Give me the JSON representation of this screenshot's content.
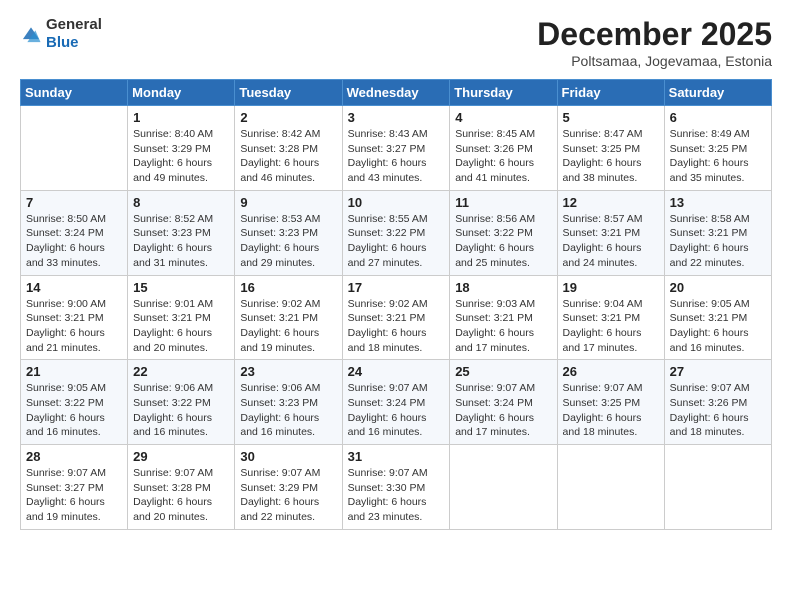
{
  "logo": {
    "general": "General",
    "blue": "Blue"
  },
  "title": "December 2025",
  "location": "Poltsamaa, Jogevamaa, Estonia",
  "days_of_week": [
    "Sunday",
    "Monday",
    "Tuesday",
    "Wednesday",
    "Thursday",
    "Friday",
    "Saturday"
  ],
  "weeks": [
    [
      {
        "day": "",
        "sunrise": "",
        "sunset": "",
        "daylight": ""
      },
      {
        "day": "1",
        "sunrise": "Sunrise: 8:40 AM",
        "sunset": "Sunset: 3:29 PM",
        "daylight": "Daylight: 6 hours and 49 minutes."
      },
      {
        "day": "2",
        "sunrise": "Sunrise: 8:42 AM",
        "sunset": "Sunset: 3:28 PM",
        "daylight": "Daylight: 6 hours and 46 minutes."
      },
      {
        "day": "3",
        "sunrise": "Sunrise: 8:43 AM",
        "sunset": "Sunset: 3:27 PM",
        "daylight": "Daylight: 6 hours and 43 minutes."
      },
      {
        "day": "4",
        "sunrise": "Sunrise: 8:45 AM",
        "sunset": "Sunset: 3:26 PM",
        "daylight": "Daylight: 6 hours and 41 minutes."
      },
      {
        "day": "5",
        "sunrise": "Sunrise: 8:47 AM",
        "sunset": "Sunset: 3:25 PM",
        "daylight": "Daylight: 6 hours and 38 minutes."
      },
      {
        "day": "6",
        "sunrise": "Sunrise: 8:49 AM",
        "sunset": "Sunset: 3:25 PM",
        "daylight": "Daylight: 6 hours and 35 minutes."
      }
    ],
    [
      {
        "day": "7",
        "sunrise": "Sunrise: 8:50 AM",
        "sunset": "Sunset: 3:24 PM",
        "daylight": "Daylight: 6 hours and 33 minutes."
      },
      {
        "day": "8",
        "sunrise": "Sunrise: 8:52 AM",
        "sunset": "Sunset: 3:23 PM",
        "daylight": "Daylight: 6 hours and 31 minutes."
      },
      {
        "day": "9",
        "sunrise": "Sunrise: 8:53 AM",
        "sunset": "Sunset: 3:23 PM",
        "daylight": "Daylight: 6 hours and 29 minutes."
      },
      {
        "day": "10",
        "sunrise": "Sunrise: 8:55 AM",
        "sunset": "Sunset: 3:22 PM",
        "daylight": "Daylight: 6 hours and 27 minutes."
      },
      {
        "day": "11",
        "sunrise": "Sunrise: 8:56 AM",
        "sunset": "Sunset: 3:22 PM",
        "daylight": "Daylight: 6 hours and 25 minutes."
      },
      {
        "day": "12",
        "sunrise": "Sunrise: 8:57 AM",
        "sunset": "Sunset: 3:21 PM",
        "daylight": "Daylight: 6 hours and 24 minutes."
      },
      {
        "day": "13",
        "sunrise": "Sunrise: 8:58 AM",
        "sunset": "Sunset: 3:21 PM",
        "daylight": "Daylight: 6 hours and 22 minutes."
      }
    ],
    [
      {
        "day": "14",
        "sunrise": "Sunrise: 9:00 AM",
        "sunset": "Sunset: 3:21 PM",
        "daylight": "Daylight: 6 hours and 21 minutes."
      },
      {
        "day": "15",
        "sunrise": "Sunrise: 9:01 AM",
        "sunset": "Sunset: 3:21 PM",
        "daylight": "Daylight: 6 hours and 20 minutes."
      },
      {
        "day": "16",
        "sunrise": "Sunrise: 9:02 AM",
        "sunset": "Sunset: 3:21 PM",
        "daylight": "Daylight: 6 hours and 19 minutes."
      },
      {
        "day": "17",
        "sunrise": "Sunrise: 9:02 AM",
        "sunset": "Sunset: 3:21 PM",
        "daylight": "Daylight: 6 hours and 18 minutes."
      },
      {
        "day": "18",
        "sunrise": "Sunrise: 9:03 AM",
        "sunset": "Sunset: 3:21 PM",
        "daylight": "Daylight: 6 hours and 17 minutes."
      },
      {
        "day": "19",
        "sunrise": "Sunrise: 9:04 AM",
        "sunset": "Sunset: 3:21 PM",
        "daylight": "Daylight: 6 hours and 17 minutes."
      },
      {
        "day": "20",
        "sunrise": "Sunrise: 9:05 AM",
        "sunset": "Sunset: 3:21 PM",
        "daylight": "Daylight: 6 hours and 16 minutes."
      }
    ],
    [
      {
        "day": "21",
        "sunrise": "Sunrise: 9:05 AM",
        "sunset": "Sunset: 3:22 PM",
        "daylight": "Daylight: 6 hours and 16 minutes."
      },
      {
        "day": "22",
        "sunrise": "Sunrise: 9:06 AM",
        "sunset": "Sunset: 3:22 PM",
        "daylight": "Daylight: 6 hours and 16 minutes."
      },
      {
        "day": "23",
        "sunrise": "Sunrise: 9:06 AM",
        "sunset": "Sunset: 3:23 PM",
        "daylight": "Daylight: 6 hours and 16 minutes."
      },
      {
        "day": "24",
        "sunrise": "Sunrise: 9:07 AM",
        "sunset": "Sunset: 3:24 PM",
        "daylight": "Daylight: 6 hours and 16 minutes."
      },
      {
        "day": "25",
        "sunrise": "Sunrise: 9:07 AM",
        "sunset": "Sunset: 3:24 PM",
        "daylight": "Daylight: 6 hours and 17 minutes."
      },
      {
        "day": "26",
        "sunrise": "Sunrise: 9:07 AM",
        "sunset": "Sunset: 3:25 PM",
        "daylight": "Daylight: 6 hours and 18 minutes."
      },
      {
        "day": "27",
        "sunrise": "Sunrise: 9:07 AM",
        "sunset": "Sunset: 3:26 PM",
        "daylight": "Daylight: 6 hours and 18 minutes."
      }
    ],
    [
      {
        "day": "28",
        "sunrise": "Sunrise: 9:07 AM",
        "sunset": "Sunset: 3:27 PM",
        "daylight": "Daylight: 6 hours and 19 minutes."
      },
      {
        "day": "29",
        "sunrise": "Sunrise: 9:07 AM",
        "sunset": "Sunset: 3:28 PM",
        "daylight": "Daylight: 6 hours and 20 minutes."
      },
      {
        "day": "30",
        "sunrise": "Sunrise: 9:07 AM",
        "sunset": "Sunset: 3:29 PM",
        "daylight": "Daylight: 6 hours and 22 minutes."
      },
      {
        "day": "31",
        "sunrise": "Sunrise: 9:07 AM",
        "sunset": "Sunset: 3:30 PM",
        "daylight": "Daylight: 6 hours and 23 minutes."
      },
      {
        "day": "",
        "sunrise": "",
        "sunset": "",
        "daylight": ""
      },
      {
        "day": "",
        "sunrise": "",
        "sunset": "",
        "daylight": ""
      },
      {
        "day": "",
        "sunrise": "",
        "sunset": "",
        "daylight": ""
      }
    ]
  ]
}
